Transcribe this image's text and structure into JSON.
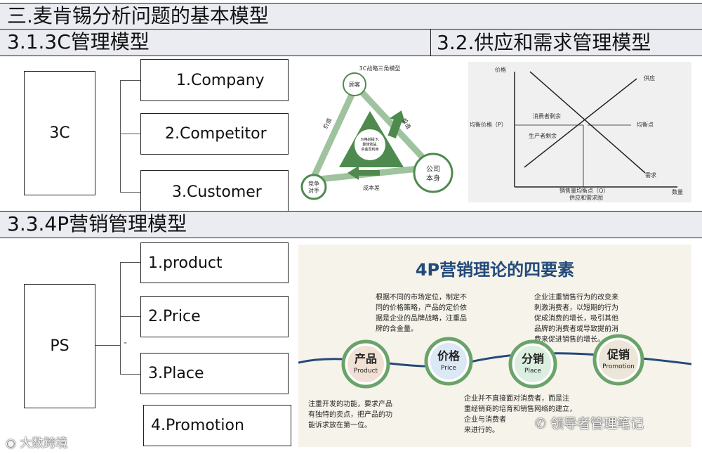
{
  "section3": {
    "title": "三.麦肯锡分析问题的基本模型"
  },
  "sec31": {
    "title": "3.1.3C管理模型",
    "root": "3C",
    "items": [
      "1.Company",
      "2.Competitor",
      "3.Customer"
    ],
    "diagram": {
      "title": "3C战略三角模型",
      "customer": "顾客",
      "competitor_l1": "竞争",
      "competitor_l2": "对手",
      "company_l1": "公司",
      "company_l2": "本身",
      "center_l1": "价格前提下,",
      "center_l2": "最佳效益,",
      "center_l3": "资金及利用",
      "left_arrow": "价值",
      "right_arrow": "价值",
      "bottom_arrow": "成本差"
    }
  },
  "sec32": {
    "title": "3.2.供应和需求管理模型",
    "graph": {
      "y_label": "价格",
      "supply": "供应",
      "demand": "需求",
      "eq_price": "均衡价格（P）",
      "eq_point": "均衡点",
      "consumer_surplus": "消费者剩余",
      "producer_surplus": "生产者剩余",
      "eq_qty": "销售量均衡点（Q）",
      "caption": "供应和需求图",
      "x_label": "数量"
    }
  },
  "sec33": {
    "title": "3.3.4P营销管理模型",
    "root": "PS",
    "dash": "-",
    "items": [
      "1.product",
      "2.Price",
      "3.Place",
      "4.Promotion"
    ],
    "poster": {
      "title": "4P营销理论的四要素",
      "text_tl1": "根据不同的市场定位，制定不",
      "text_tl2": "同的价格策略，产品的定价依",
      "text_tl3": "据是企业的品牌战略，注重品",
      "text_tl4": "牌的含金量。",
      "text_tr1": "企业注重销售行为的改变来",
      "text_tr2": "刺激消费者，以短期的行为",
      "text_tr3": "促成消费的增长，吸引其他",
      "text_tr4": "品牌的消费者或导致提前消",
      "text_tr5": "费来促进销售的增长。",
      "text_bl1": "注重开发的功能，要求产品",
      "text_bl2": "有独特的卖点，把产品的功",
      "text_bl3": "能诉求放在第一位。",
      "text_br1": "企业并不直接面对消费者，而是注",
      "text_br2": "重经销商的培育和销售网络的建立，",
      "text_br3": "企业与消费者",
      "text_br4": "来进行的。",
      "circles": [
        {
          "cn": "产品",
          "en": "Product"
        },
        {
          "cn": "价格",
          "en": "Price"
        },
        {
          "cn": "分销",
          "en": "Place"
        },
        {
          "cn": "促销",
          "en": "Promotion"
        }
      ]
    }
  },
  "watermarks": {
    "left": "大数跨境",
    "right": "领导者管理笔记"
  }
}
